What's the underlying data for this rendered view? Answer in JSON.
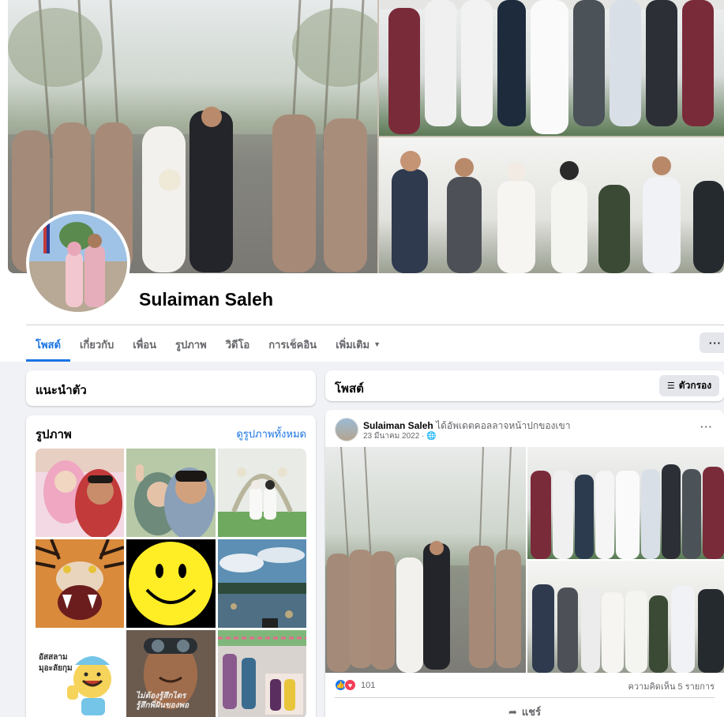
{
  "profile": {
    "name": "Sulaiman Saleh"
  },
  "tabs": [
    {
      "label": "โพสต์",
      "active": true
    },
    {
      "label": "เกี่ยวกับ"
    },
    {
      "label": "เพื่อน"
    },
    {
      "label": "รูปภาพ"
    },
    {
      "label": "วิดีโอ"
    },
    {
      "label": "การเช็คอิน"
    },
    {
      "label": "เพิ่มเติม",
      "has_caret": true
    }
  ],
  "more_button_label": "···",
  "intro": {
    "title": "แนะนำตัว"
  },
  "photos": {
    "title": "รูปภาพ",
    "see_all": "ดูรูปภาพทั้งหมด",
    "items": [
      {
        "desc": "selfie-couple-pink-hijab"
      },
      {
        "desc": "selfie-couple-peace-sign"
      },
      {
        "desc": "wedding-arch-couple"
      },
      {
        "desc": "tiger-roaring"
      },
      {
        "desc": "yellow-smiley-face"
      },
      {
        "desc": "lake-cloudy-sky"
      },
      {
        "desc": "cartoon-greeting-sticker",
        "text_line1": "อัสสลาม",
        "text_line2": "มุอะลัยกุม"
      },
      {
        "desc": "man-with-goggles-meme",
        "text_line1": "ไม่ต้องรู้สึกไดร",
        "text_line2": "รู้สึกพี่ฝันของพอ"
      },
      {
        "desc": "decorated-party-room"
      }
    ]
  },
  "posts_header": {
    "title": "โพสต์",
    "filter_label": "ตัวกรอง"
  },
  "post": {
    "author": "Sulaiman Saleh",
    "action": "ได้อัพเดตคอลลาจหน้าปกของเขา",
    "date": "23 มีนาคม 2022",
    "privacy_icon": "globe-icon",
    "reaction_count": "101",
    "comments": "ความคิดเห็น 5 รายการ",
    "share_label": "แชร์"
  },
  "colors": {
    "accent": "#1b74e4",
    "background": "#f0f2f5",
    "like": "#1877f2",
    "love": "#f33e58"
  }
}
